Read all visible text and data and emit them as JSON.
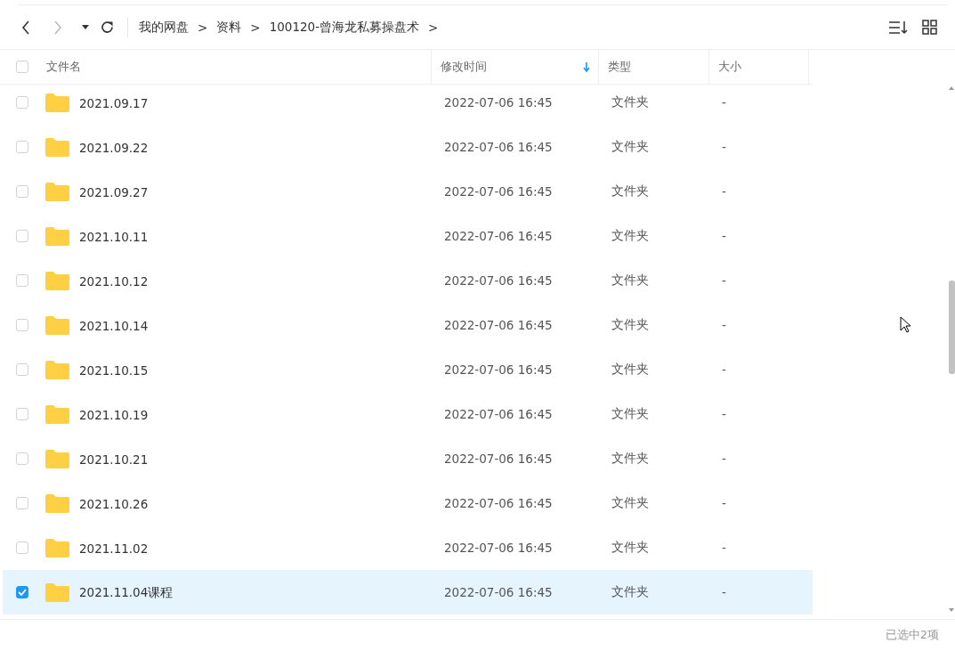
{
  "toolbar": {
    "breadcrumbs": [
      "我的网盘",
      "资料",
      "100120-曾海龙私募操盘术"
    ],
    "separator": ">"
  },
  "table": {
    "columns": [
      {
        "label": "文件名",
        "sorted": false
      },
      {
        "label": "修改时间",
        "sorted": true
      },
      {
        "label": "类型",
        "sorted": false
      },
      {
        "label": "大小",
        "sorted": false
      }
    ],
    "header_checked": false,
    "rows": [
      {
        "name": "2021.09.17",
        "modified": "2022-07-06 16:45",
        "type": "文件夹",
        "size": "-",
        "selected": false
      },
      {
        "name": "2021.09.22",
        "modified": "2022-07-06 16:45",
        "type": "文件夹",
        "size": "-",
        "selected": false
      },
      {
        "name": "2021.09.27",
        "modified": "2022-07-06 16:45",
        "type": "文件夹",
        "size": "-",
        "selected": false
      },
      {
        "name": "2021.10.11",
        "modified": "2022-07-06 16:45",
        "type": "文件夹",
        "size": "-",
        "selected": false
      },
      {
        "name": "2021.10.12",
        "modified": "2022-07-06 16:45",
        "type": "文件夹",
        "size": "-",
        "selected": false
      },
      {
        "name": "2021.10.14",
        "modified": "2022-07-06 16:45",
        "type": "文件夹",
        "size": "-",
        "selected": false
      },
      {
        "name": "2021.10.15",
        "modified": "2022-07-06 16:45",
        "type": "文件夹",
        "size": "-",
        "selected": false
      },
      {
        "name": "2021.10.19",
        "modified": "2022-07-06 16:45",
        "type": "文件夹",
        "size": "-",
        "selected": false
      },
      {
        "name": "2021.10.21",
        "modified": "2022-07-06 16:45",
        "type": "文件夹",
        "size": "-",
        "selected": false
      },
      {
        "name": "2021.10.26",
        "modified": "2022-07-06 16:45",
        "type": "文件夹",
        "size": "-",
        "selected": false
      },
      {
        "name": "2021.11.02",
        "modified": "2022-07-06 16:45",
        "type": "文件夹",
        "size": "-",
        "selected": false
      },
      {
        "name": "2021.11.04课程",
        "modified": "2022-07-06 16:45",
        "type": "文件夹",
        "size": "-",
        "selected": true
      }
    ]
  },
  "status_bar": {
    "text": "已选中2项"
  }
}
